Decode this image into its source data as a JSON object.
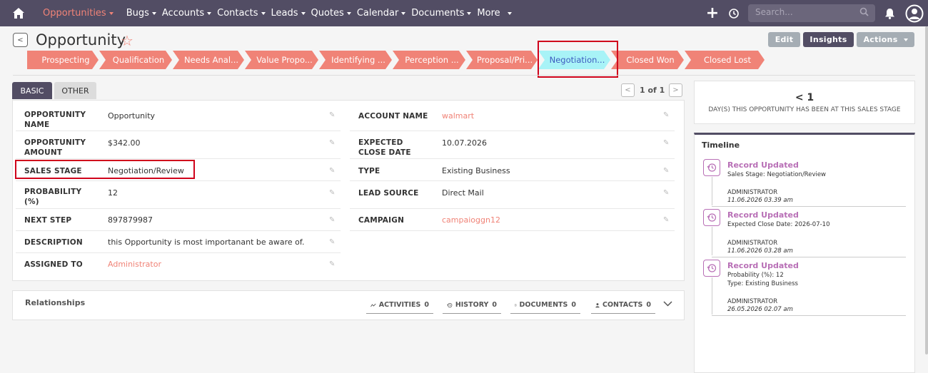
{
  "nav": {
    "items": [
      {
        "label": "Opportunities",
        "active": true
      },
      {
        "label": "Bugs"
      },
      {
        "label": "Accounts"
      },
      {
        "label": "Contacts"
      },
      {
        "label": "Leads"
      },
      {
        "label": "Quotes"
      },
      {
        "label": "Calendar"
      },
      {
        "label": "Documents"
      },
      {
        "label": "More"
      }
    ],
    "search_placeholder": "Search..."
  },
  "header": {
    "title": "Opportunity",
    "buttons": {
      "edit": "Edit",
      "insights": "Insights",
      "actions": "Actions"
    }
  },
  "stages": [
    {
      "label": "Prospecting"
    },
    {
      "label": "Qualification"
    },
    {
      "label": "Needs Anal..."
    },
    {
      "label": "Value Propo..."
    },
    {
      "label": "Identifying ..."
    },
    {
      "label": "Perception ..."
    },
    {
      "label": "Proposal/Pri..."
    },
    {
      "label": "Negotiation...",
      "current": true
    },
    {
      "label": "Closed Won"
    },
    {
      "label": "Closed Lost"
    }
  ],
  "tabs": {
    "basic": "BASIC",
    "other": "OTHER"
  },
  "pager": {
    "text": "1 of 1",
    "prev": "<",
    "next": ">"
  },
  "fields": {
    "opportunity_name": {
      "label1": "OPPORTUNITY",
      "label2": "NAME",
      "value": "Opportunity"
    },
    "opportunity_amount": {
      "label1": "OPPORTUNITY",
      "label2": "AMOUNT",
      "value": "$342.00"
    },
    "sales_stage": {
      "label": "SALES STAGE",
      "value": "Negotiation/Review"
    },
    "probability": {
      "label1": "PROBABILITY",
      "label2": "(%)",
      "value": "12"
    },
    "next_step": {
      "label": "NEXT STEP",
      "value": "897879987"
    },
    "description": {
      "label": "DESCRIPTION",
      "value": "this Opportunity is most importanant be aware of."
    },
    "assigned_to": {
      "label": "ASSIGNED TO",
      "value": "Administrator"
    },
    "account_name": {
      "label": "ACCOUNT NAME",
      "value": "walmart"
    },
    "expected_close_date": {
      "label1": "EXPECTED",
      "label2": "CLOSE DATE",
      "value": "10.07.2026"
    },
    "type": {
      "label": "TYPE",
      "value": "Existing Business"
    },
    "lead_source": {
      "label": "LEAD SOURCE",
      "value": "Direct Mail"
    },
    "campaign": {
      "label": "CAMPAIGN",
      "value": "campaioggn12"
    }
  },
  "relationships": {
    "title": "Relationships",
    "tabs": [
      {
        "label": "ACTIVITIES",
        "count": "0"
      },
      {
        "label": "HISTORY",
        "count": "0"
      },
      {
        "label": "DOCUMENTS",
        "count": "0"
      },
      {
        "label": "CONTACTS",
        "count": "0"
      }
    ]
  },
  "days_at_stage": {
    "value": "< 1",
    "text": "DAY(S) THIS OPPORTUNITY HAS BEEN AT THIS SALES STAGE"
  },
  "timeline": {
    "title": "Timeline",
    "entries": [
      {
        "heading": "Record Updated",
        "lines": [
          "Sales Stage: Negotiation/Review"
        ],
        "user": "ADMINISTRATOR",
        "time": "11.06.2026 03.39 am"
      },
      {
        "heading": "Record Updated",
        "lines": [
          "Expected Close Date: 2026-07-10"
        ],
        "user": "ADMINISTRATOR",
        "time": "11.06.2026 03.28 am"
      },
      {
        "heading": "Record Updated",
        "lines": [
          "Probability (%): 12",
          "Type: Existing Business"
        ],
        "user": "ADMINISTRATOR",
        "time": "26.05.2026 02.07 am"
      }
    ]
  },
  "colors": {
    "navbar": "#524d64",
    "accent": "#f08377",
    "stage_current": "#a8f3f7",
    "timeline_accent": "#b86fb6",
    "highlight": "#d0021b"
  }
}
